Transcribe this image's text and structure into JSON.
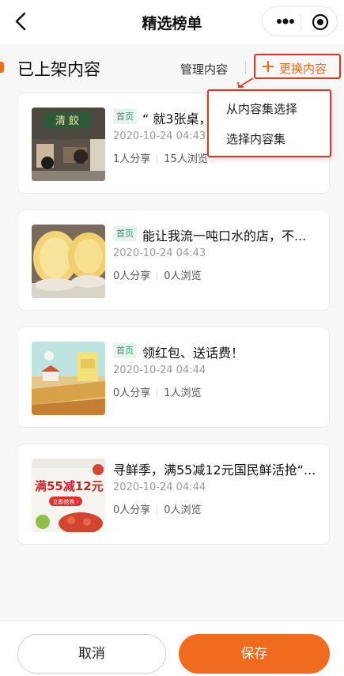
{
  "nav": {
    "title": "精选榜单",
    "back_icon": "chevron-left-icon",
    "more_icon": "more-dots-icon",
    "close_icon": "target-circle-icon"
  },
  "section": {
    "heading": "已上架内容",
    "manage_label": "管理内容",
    "replace_label": "更换内容",
    "accent_color": "#f06a20",
    "highlight_color": "#e8321d"
  },
  "dropdown": {
    "options": [
      "从内容集选择",
      "选择内容集"
    ]
  },
  "items": [
    {
      "tag": "首页",
      "title": "“ 就3张桌，",
      "date": "2020-10-24 04:43",
      "shares": "1人分享",
      "views": "15人浏览",
      "thumb_text": "清 餃"
    },
    {
      "tag": "首页",
      "title": "能让我流一吨口水的店，不...",
      "date": "2020-10-24 04:43",
      "shares": "0人分享",
      "views": "0人浏览"
    },
    {
      "tag": "首页",
      "title": "领红包、送话费！",
      "date": "2020-10-24 04:44",
      "shares": "0人分享",
      "views": "1人浏览"
    },
    {
      "tag": "",
      "title": "寻鲜季，满55减12元国民鲜活抢“...",
      "date": "2020-10-24 04:44",
      "shares": "0人分享",
      "views": "0人浏览",
      "thumb_text": "满55减12元",
      "thumb_btn": "立即抢购 ›"
    }
  ],
  "footer": {
    "cancel_label": "取消",
    "save_label": "保存"
  }
}
